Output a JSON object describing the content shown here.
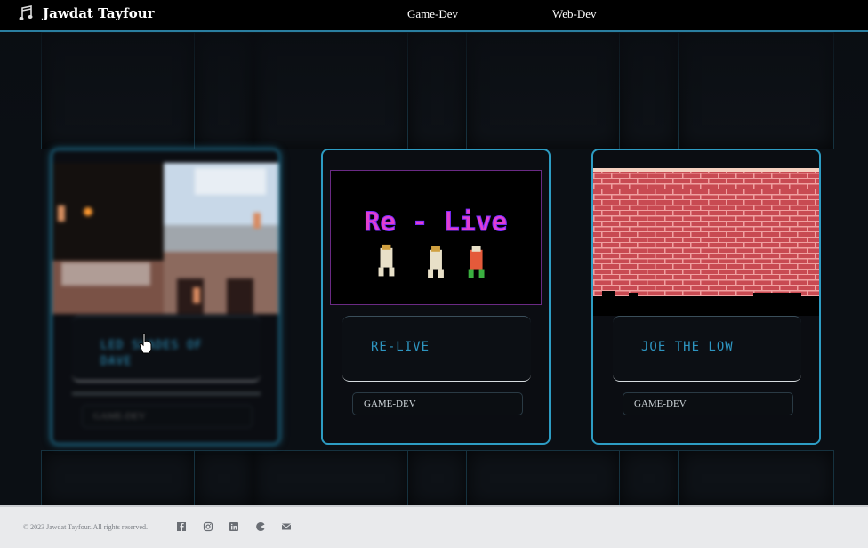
{
  "navbar": {
    "brand": "Jawdat Tayfour",
    "brand_icon": "music-note-icon",
    "links": [
      "Game-Dev",
      "Web-Dev"
    ]
  },
  "cards": [
    {
      "title": "LED SHADES OF DAVE",
      "tag": "GAME-DEV"
    },
    {
      "title": "RE-LIVE",
      "tag": "GAME-DEV",
      "thumb_text": "Re - Live"
    },
    {
      "title": "JOE THE LOW",
      "tag": "GAME-DEV"
    }
  ],
  "footer": {
    "copyright": "© 2023 Jawdat Tayfour. All rights reserved.",
    "social_icons": [
      "facebook-icon",
      "instagram-icon",
      "linkedin-icon",
      "pacman-icon",
      "mail-icon"
    ]
  },
  "colors": {
    "accent": "#2d9cc3",
    "title_text": "#2e95c0",
    "footer_bg": "#e9eaec"
  }
}
